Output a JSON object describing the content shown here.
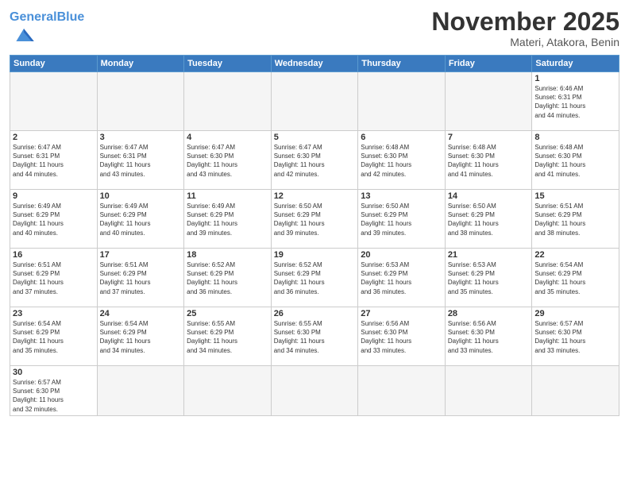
{
  "header": {
    "logo_general": "General",
    "logo_blue": "Blue",
    "month_title": "November 2025",
    "location": "Materi, Atakora, Benin"
  },
  "weekdays": [
    "Sunday",
    "Monday",
    "Tuesday",
    "Wednesday",
    "Thursday",
    "Friday",
    "Saturday"
  ],
  "weeks": [
    [
      {
        "day": "",
        "info": ""
      },
      {
        "day": "",
        "info": ""
      },
      {
        "day": "",
        "info": ""
      },
      {
        "day": "",
        "info": ""
      },
      {
        "day": "",
        "info": ""
      },
      {
        "day": "",
        "info": ""
      },
      {
        "day": "1",
        "info": "Sunrise: 6:46 AM\nSunset: 6:31 PM\nDaylight: 11 hours\nand 44 minutes."
      }
    ],
    [
      {
        "day": "2",
        "info": "Sunrise: 6:47 AM\nSunset: 6:31 PM\nDaylight: 11 hours\nand 44 minutes."
      },
      {
        "day": "3",
        "info": "Sunrise: 6:47 AM\nSunset: 6:31 PM\nDaylight: 11 hours\nand 43 minutes."
      },
      {
        "day": "4",
        "info": "Sunrise: 6:47 AM\nSunset: 6:30 PM\nDaylight: 11 hours\nand 43 minutes."
      },
      {
        "day": "5",
        "info": "Sunrise: 6:47 AM\nSunset: 6:30 PM\nDaylight: 11 hours\nand 42 minutes."
      },
      {
        "day": "6",
        "info": "Sunrise: 6:48 AM\nSunset: 6:30 PM\nDaylight: 11 hours\nand 42 minutes."
      },
      {
        "day": "7",
        "info": "Sunrise: 6:48 AM\nSunset: 6:30 PM\nDaylight: 11 hours\nand 41 minutes."
      },
      {
        "day": "8",
        "info": "Sunrise: 6:48 AM\nSunset: 6:30 PM\nDaylight: 11 hours\nand 41 minutes."
      }
    ],
    [
      {
        "day": "9",
        "info": "Sunrise: 6:49 AM\nSunset: 6:29 PM\nDaylight: 11 hours\nand 40 minutes."
      },
      {
        "day": "10",
        "info": "Sunrise: 6:49 AM\nSunset: 6:29 PM\nDaylight: 11 hours\nand 40 minutes."
      },
      {
        "day": "11",
        "info": "Sunrise: 6:49 AM\nSunset: 6:29 PM\nDaylight: 11 hours\nand 39 minutes."
      },
      {
        "day": "12",
        "info": "Sunrise: 6:50 AM\nSunset: 6:29 PM\nDaylight: 11 hours\nand 39 minutes."
      },
      {
        "day": "13",
        "info": "Sunrise: 6:50 AM\nSunset: 6:29 PM\nDaylight: 11 hours\nand 39 minutes."
      },
      {
        "day": "14",
        "info": "Sunrise: 6:50 AM\nSunset: 6:29 PM\nDaylight: 11 hours\nand 38 minutes."
      },
      {
        "day": "15",
        "info": "Sunrise: 6:51 AM\nSunset: 6:29 PM\nDaylight: 11 hours\nand 38 minutes."
      }
    ],
    [
      {
        "day": "16",
        "info": "Sunrise: 6:51 AM\nSunset: 6:29 PM\nDaylight: 11 hours\nand 37 minutes."
      },
      {
        "day": "17",
        "info": "Sunrise: 6:51 AM\nSunset: 6:29 PM\nDaylight: 11 hours\nand 37 minutes."
      },
      {
        "day": "18",
        "info": "Sunrise: 6:52 AM\nSunset: 6:29 PM\nDaylight: 11 hours\nand 36 minutes."
      },
      {
        "day": "19",
        "info": "Sunrise: 6:52 AM\nSunset: 6:29 PM\nDaylight: 11 hours\nand 36 minutes."
      },
      {
        "day": "20",
        "info": "Sunrise: 6:53 AM\nSunset: 6:29 PM\nDaylight: 11 hours\nand 36 minutes."
      },
      {
        "day": "21",
        "info": "Sunrise: 6:53 AM\nSunset: 6:29 PM\nDaylight: 11 hours\nand 35 minutes."
      },
      {
        "day": "22",
        "info": "Sunrise: 6:54 AM\nSunset: 6:29 PM\nDaylight: 11 hours\nand 35 minutes."
      }
    ],
    [
      {
        "day": "23",
        "info": "Sunrise: 6:54 AM\nSunset: 6:29 PM\nDaylight: 11 hours\nand 35 minutes."
      },
      {
        "day": "24",
        "info": "Sunrise: 6:54 AM\nSunset: 6:29 PM\nDaylight: 11 hours\nand 34 minutes."
      },
      {
        "day": "25",
        "info": "Sunrise: 6:55 AM\nSunset: 6:29 PM\nDaylight: 11 hours\nand 34 minutes."
      },
      {
        "day": "26",
        "info": "Sunrise: 6:55 AM\nSunset: 6:30 PM\nDaylight: 11 hours\nand 34 minutes."
      },
      {
        "day": "27",
        "info": "Sunrise: 6:56 AM\nSunset: 6:30 PM\nDaylight: 11 hours\nand 33 minutes."
      },
      {
        "day": "28",
        "info": "Sunrise: 6:56 AM\nSunset: 6:30 PM\nDaylight: 11 hours\nand 33 minutes."
      },
      {
        "day": "29",
        "info": "Sunrise: 6:57 AM\nSunset: 6:30 PM\nDaylight: 11 hours\nand 33 minutes."
      }
    ],
    [
      {
        "day": "30",
        "info": "Sunrise: 6:57 AM\nSunset: 6:30 PM\nDaylight: 11 hours\nand 32 minutes."
      },
      {
        "day": "",
        "info": ""
      },
      {
        "day": "",
        "info": ""
      },
      {
        "day": "",
        "info": ""
      },
      {
        "day": "",
        "info": ""
      },
      {
        "day": "",
        "info": ""
      },
      {
        "day": "",
        "info": ""
      }
    ]
  ]
}
